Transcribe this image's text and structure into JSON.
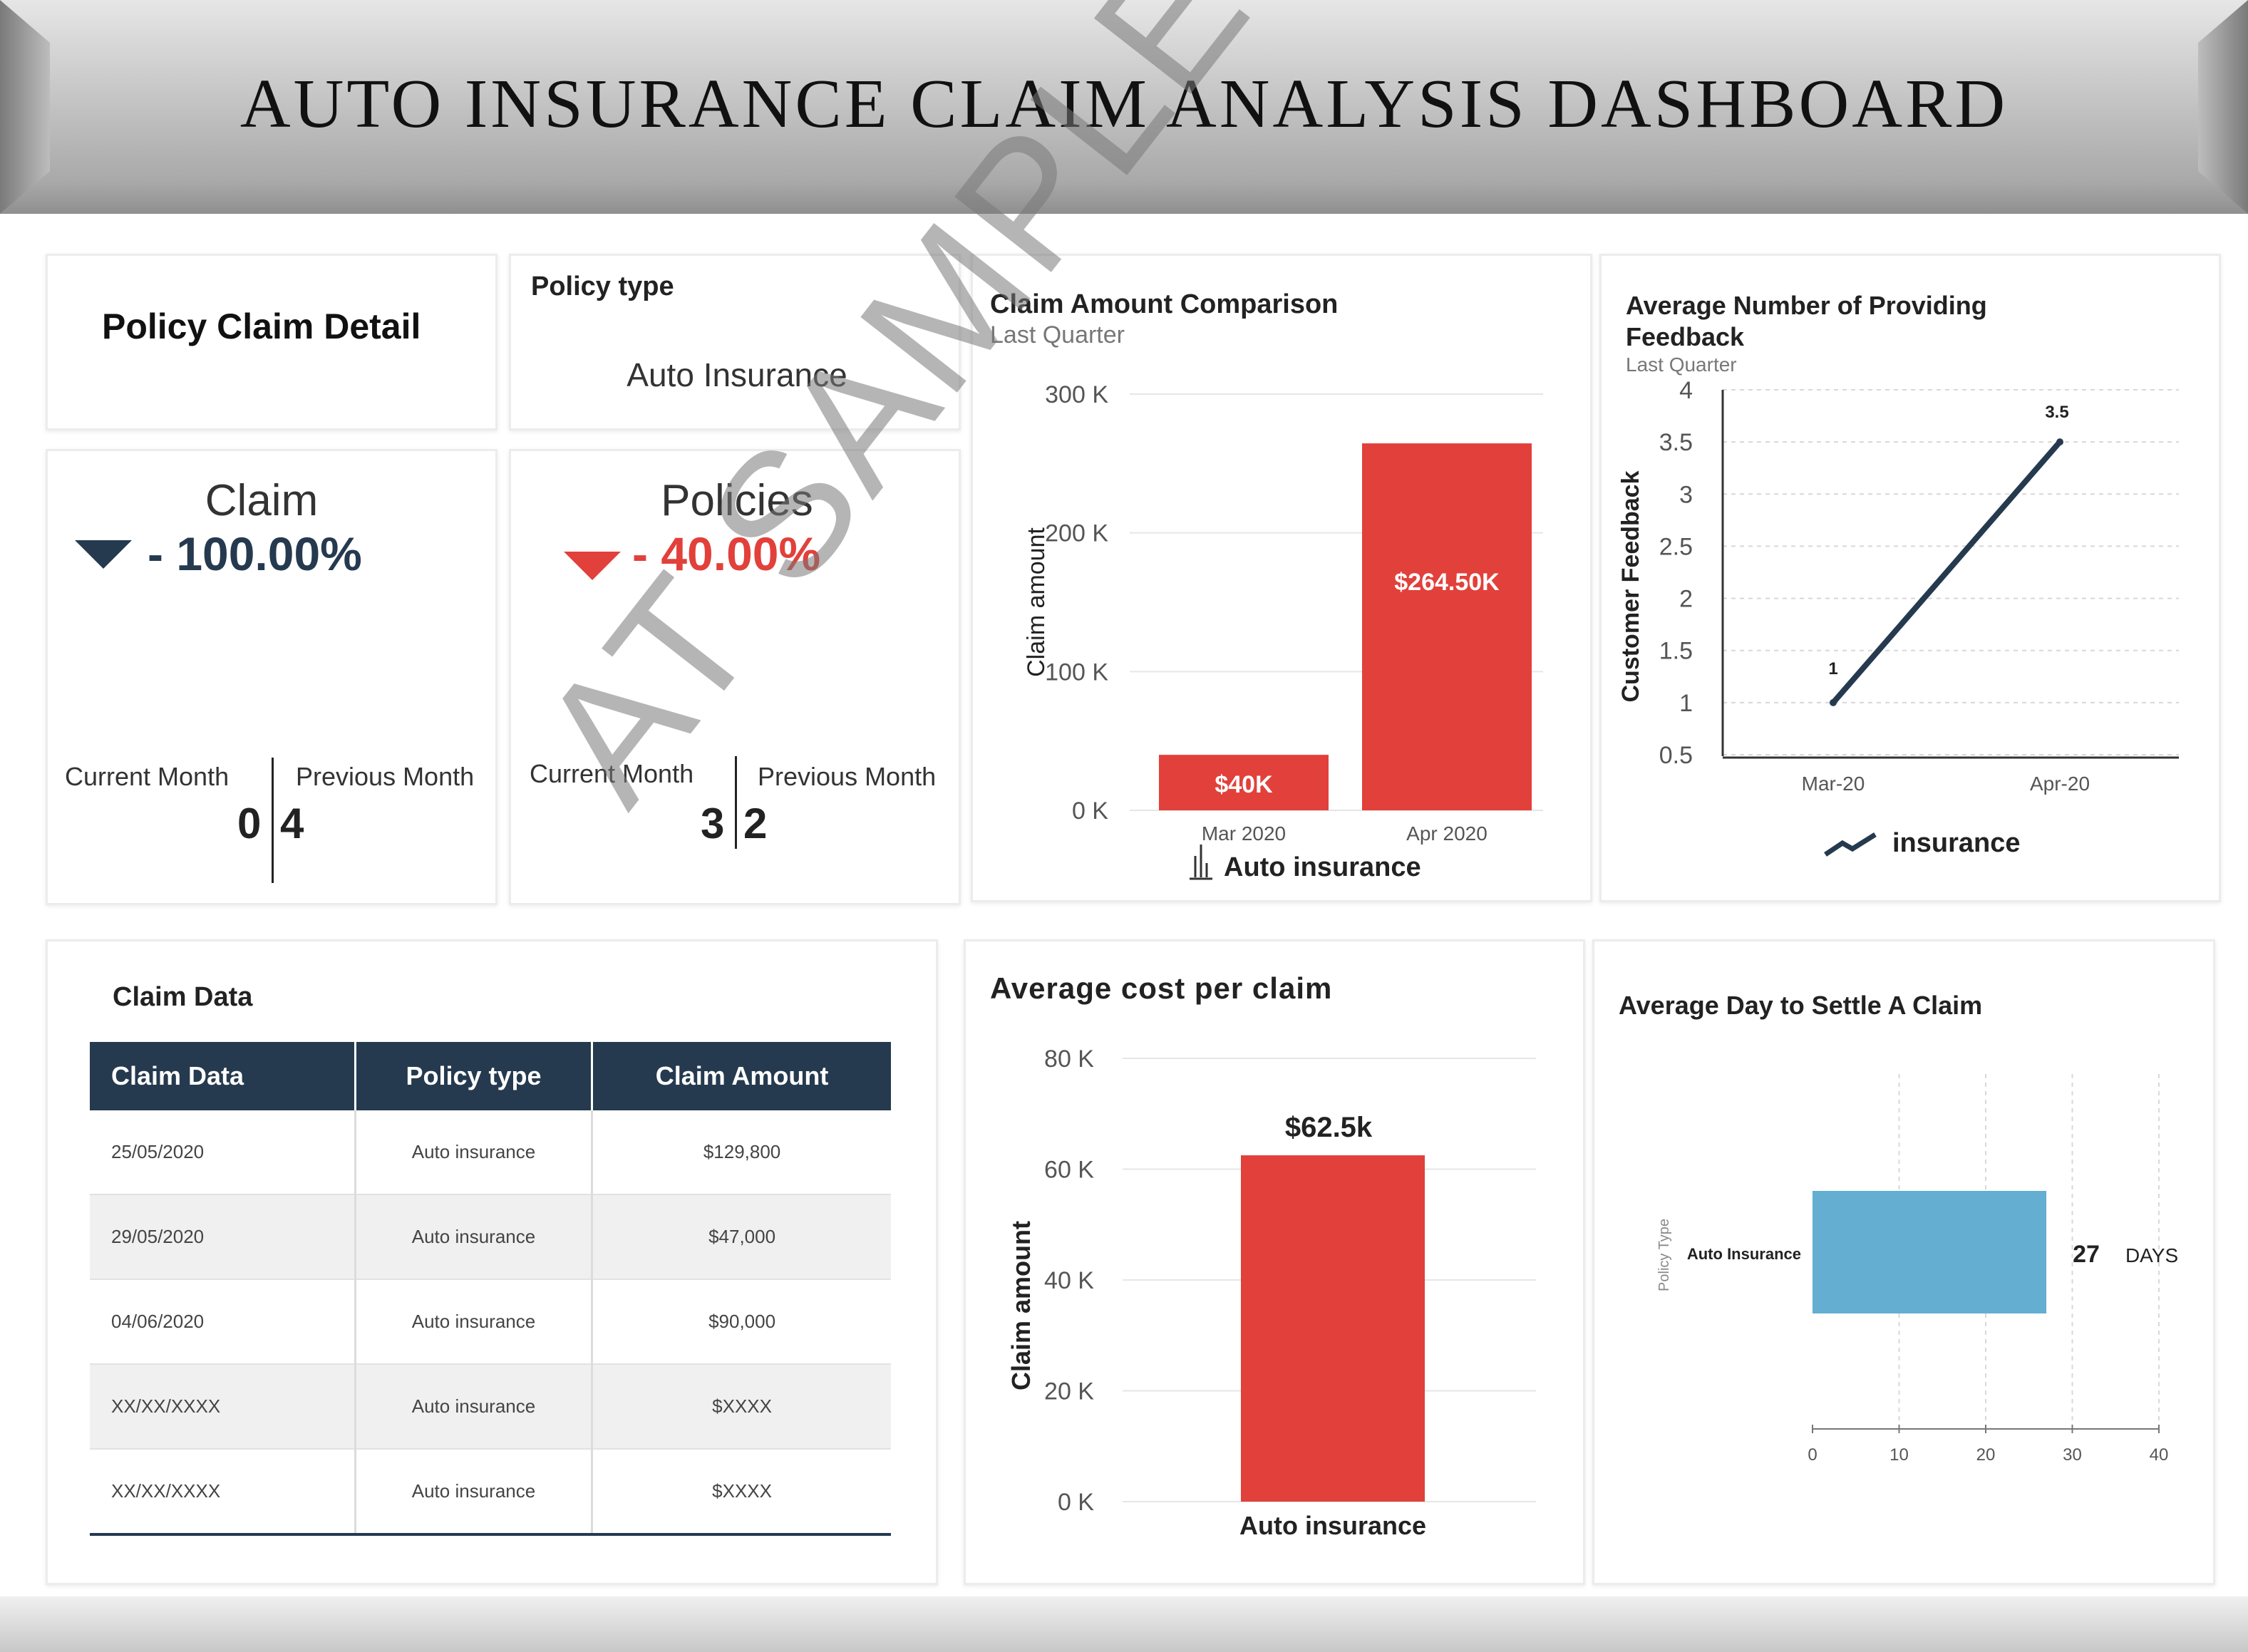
{
  "header": {
    "title": "AUTO INSURANCE CLAIM ANALYSIS DASHBOARD"
  },
  "policy_claim_detail": {
    "title": "Policy Claim Detail"
  },
  "policy_type": {
    "label": "Policy type",
    "value": "Auto Insurance"
  },
  "claim_kpi": {
    "title": "Claim",
    "change": "- 100.00%",
    "direction_color": "#253a4f",
    "current_label": "Current Month",
    "previous_label": "Previous Month",
    "current_value": "0",
    "previous_value": "4"
  },
  "policies_kpi": {
    "title": "Policies",
    "change": "- 40.00%",
    "direction_color": "#e2403a",
    "current_label": "Current Month",
    "previous_label": "Previous Month",
    "current_value": "3",
    "previous_value": "2"
  },
  "claim_table": {
    "title": "Claim Data",
    "headers": [
      "Claim Data",
      "Policy type",
      "Claim Amount"
    ],
    "rows": [
      [
        "25/05/2020",
        "Auto insurance",
        "$129,800"
      ],
      [
        "29/05/2020",
        "Auto insurance",
        "$47,000"
      ],
      [
        "04/06/2020",
        "Auto insurance",
        "$90,000"
      ],
      [
        "XX/XX/XXXX",
        "Auto insurance",
        "$XXXX"
      ],
      [
        "XX/XX/XXXX",
        "Auto insurance",
        "$XXXX"
      ]
    ]
  },
  "watermark": "AT SAMPLE",
  "chart_data": [
    {
      "type": "bar",
      "title": "Claim Amount Comparison",
      "subtitle": "Last Quarter",
      "ylabel": "Claim amount",
      "categories": [
        "Mar 2020",
        "Apr 2020"
      ],
      "values": [
        40000,
        264500
      ],
      "data_labels": [
        "$40K",
        "$264.50K"
      ],
      "series": [
        {
          "name": "Auto insurance",
          "values": [
            40000,
            264500
          ]
        }
      ],
      "ylim": [
        0,
        300000
      ],
      "yticks": [
        "0 K",
        "100 K",
        "200 K",
        "300 K"
      ],
      "color": "#e2403a",
      "grid": true,
      "legend": "bottom"
    },
    {
      "type": "line",
      "title": "Average Number of Providing Feedback",
      "subtitle": "Last Quarter",
      "ylabel": "Customer Feedback",
      "categories": [
        "Mar-20",
        "Apr-20"
      ],
      "series": [
        {
          "name": "insurance",
          "values": [
            1,
            3.5
          ]
        }
      ],
      "data_labels": [
        "1",
        "3.5"
      ],
      "ylim": [
        0.5,
        4
      ],
      "yticks": [
        "0.5",
        "1",
        "1.5",
        "2",
        "2.5",
        "3",
        "3.5",
        "4"
      ],
      "color": "#253a4f",
      "grid": true,
      "legend": "bottom"
    },
    {
      "type": "bar",
      "title": "Average cost per claim",
      "ylabel": "Claim amount",
      "categories": [
        "Auto insurance"
      ],
      "values": [
        62500
      ],
      "data_labels": [
        "$62.5k"
      ],
      "ylim": [
        0,
        80000
      ],
      "yticks": [
        "0 K",
        "20 K",
        "40 K",
        "60 K",
        "80 K"
      ],
      "color": "#e2403a",
      "grid": true
    },
    {
      "type": "bar",
      "orientation": "horizontal",
      "title": "Average Day to Settle A Claim",
      "ylabel": "Policy Type",
      "categories": [
        "Auto Insurance"
      ],
      "values": [
        27
      ],
      "data_labels": [
        "27",
        "DAYS"
      ],
      "xlim": [
        0,
        40
      ],
      "xticks": [
        "0",
        "10",
        "20",
        "30",
        "40"
      ],
      "color": "#63aed1",
      "grid": true
    }
  ]
}
